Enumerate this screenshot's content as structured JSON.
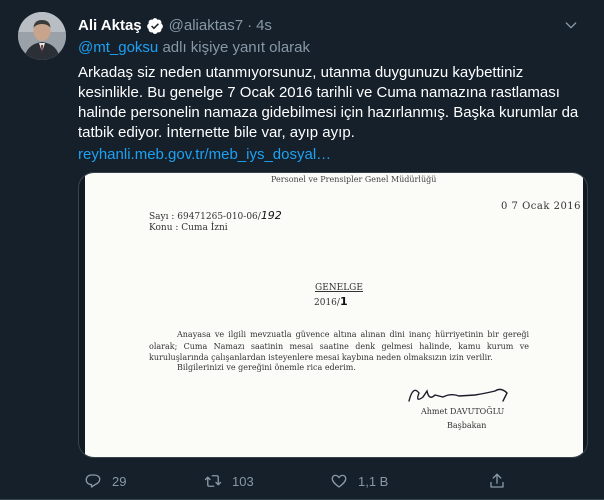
{
  "tweet": {
    "display_name": "Ali Aktaş",
    "handle": "@aliaktas7",
    "separator": "·",
    "time": "4s",
    "reply_mention": "@mt_goksu",
    "reply_suffix": "adlı kişiye yanıt olarak",
    "text": "Arkadaş siz neden utanmıyorsunuz, utanma duygunuzu kaybettiniz kesinlikle. Bu genelge 7 Ocak 2016 tarihli ve Cuma namazına rastlaması halinde personelin namaza gidebilmesi için hazırlanmış. Başka kurumlar da tatbik ediyor. İnternette bile var, ayıp ayıp.",
    "link": "reyhanli.meb.gov.tr/meb_iys_dosyal…"
  },
  "document": {
    "org": "Personel ve Prensipler Genel Müdürlüğü",
    "sayi_label": "Sayı   : 69471265-010-06/",
    "sayi_handwritten": "192",
    "konu_label": "Konu   : Cuma İzni",
    "date_stamp": "0 7 Ocak 2016",
    "genelge_title": "GENELGE",
    "genelge_year": "2016/",
    "genelge_number": "1",
    "body": "Anayasa ve ilgili mevzuatla güvence altına alınan dini inanç hürriyetinin bir gereği olarak; Cuma Namazı saatinin mesai saatine denk gelmesi halinde, kamu kurum ve kuruluşlarında çalışanlardan isteyenlere mesai kaybına neden olmaksızın izin verilir.",
    "closing": "Bilgilerinizi ve gereğini önemle rica ederim.",
    "signer": "Ahmet DAVUTOĞLU",
    "signer_title": "Başbakan"
  },
  "actions": {
    "reply_count": "29",
    "retweet_count": "103",
    "like_count": "1,1 B"
  },
  "colors": {
    "background": "#15202b",
    "accent": "#1da1f2",
    "muted": "#8899a6",
    "border": "#38444d"
  }
}
